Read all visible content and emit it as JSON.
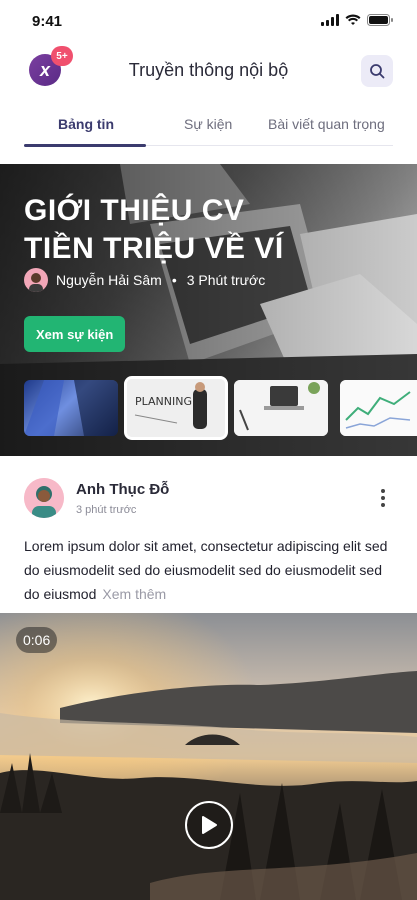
{
  "status_bar": {
    "time": "9:41"
  },
  "header": {
    "logo_letter": "x",
    "logo_badge": "5+",
    "title": "Truyền thông nội bộ",
    "search_icon": "search-icon"
  },
  "tabs": [
    {
      "label": "Bảng tin",
      "active": true
    },
    {
      "label": "Sự kiện",
      "active": false
    },
    {
      "label": "Bài viết quan trọng",
      "active": false
    }
  ],
  "hero": {
    "title_line1": "GIỚI THIỆU CV",
    "title_line2": "TIỀN TRIỆU VỀ VÍ",
    "author": "Nguyễn Hải Sâm",
    "separator": "•",
    "time": "3 Phút trước",
    "button_label": "Xem sự kiện",
    "thumbnails": [
      "building",
      "planning",
      "laptop-desk",
      "charts"
    ],
    "selected_thumbnail": 1
  },
  "post": {
    "author": "Anh Thục Đỗ",
    "time": "3 phút trước",
    "text": "Lorem ipsum dolor sit amet, consectetur adipiscing elit sed do eiusmodelit sed do eiusmodelit sed do eiusmodelit sed do eiusmod",
    "see_more": "Xem thêm",
    "more_icon": "more-vertical-icon"
  },
  "video": {
    "duration": "0:06",
    "play_icon": "play-icon"
  },
  "colors": {
    "accent": "#3b3b6e",
    "button_green": "#22b573",
    "badge_red": "#f0506e",
    "logo_purple": "#6b3696"
  }
}
